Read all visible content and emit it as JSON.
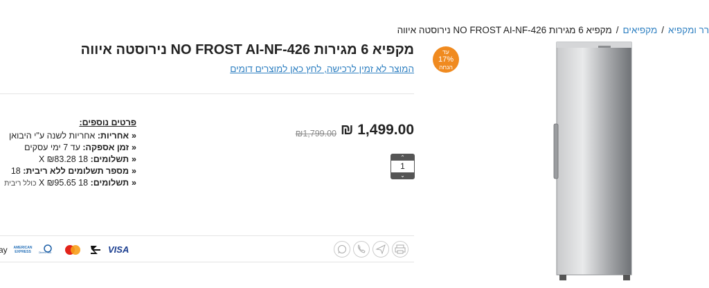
{
  "breadcrumb": {
    "items": [
      "קרר ומקפיא",
      "מקפיאים"
    ],
    "separator": "/",
    "current": "מקפיא 6 מגירות NO FROST AI-NF-426 נירוסטה איווה"
  },
  "badge": {
    "line1": "עד",
    "percent": "17%",
    "line2": "הנחה",
    "color": "#f08a1f"
  },
  "product": {
    "title": "מקפיא 6 מגירות NO FROST AI-NF-426 נירוסטה איווה",
    "notice": "המוצר לא זמין לרכישה, לחץ כאן למוצרים דומים",
    "price": "1,499.00 ₪",
    "old_price": "₪1,799.00",
    "quantity": "1"
  },
  "details": {
    "heading": "פרטים נוספים:",
    "rows": [
      {
        "label": "אחריות:",
        "value": "אחריות לשנה ע\"י היבואן"
      },
      {
        "label": "זמן אספקה:",
        "value": "עד 7 ימי עסקים"
      },
      {
        "label": "תשלומים:",
        "value": "18 X ₪83.28"
      },
      {
        "label": "מספר תשלומים ללא ריבית:",
        "value": "18"
      },
      {
        "label": "תשלומים:",
        "value": "18 X ₪95.65",
        "note": "כולל ריבית"
      }
    ]
  },
  "payments": {
    "visa": "VISA",
    "amex": "AMERICAN EXPRESS",
    "diners": "Diners Club",
    "partial": "ay"
  },
  "colors": {
    "link": "#2d7fc1",
    "accent": "#f08a1f"
  }
}
